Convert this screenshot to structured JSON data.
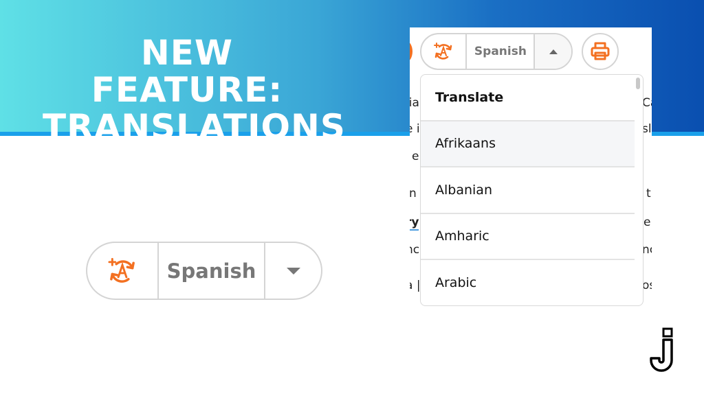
{
  "banner": {
    "title_line1": "NEW FEATURE:",
    "title_line2": "TRANSLATIONS"
  },
  "screenshot": {
    "translate_button": {
      "language": "Spanish",
      "icon": "translate-icon",
      "arrow": "caret-up-icon"
    },
    "print_button": {
      "icon": "printer-icon"
    },
    "dropdown": {
      "header": "Translate",
      "items": [
        "Afrikaans",
        "Albanian",
        "Amharic",
        "Arabic"
      ],
      "highlighted": "Afrikaans"
    },
    "background_fragments": [
      "lia",
      "Ca",
      "e i",
      "sl",
      "e",
      "n",
      "t",
      "ry",
      "e",
      "nc",
      "nc",
      "a |",
      "os"
    ]
  },
  "large_button": {
    "language": "Spanish",
    "icon": "translate-icon",
    "arrow": "caret-down-icon"
  },
  "colors": {
    "accent": "#f37021",
    "banner_start": "#5fe0e6",
    "banner_end": "#0a4fb0",
    "stripe": "#1aa0ea"
  },
  "logo": {
    "letter": "J"
  }
}
